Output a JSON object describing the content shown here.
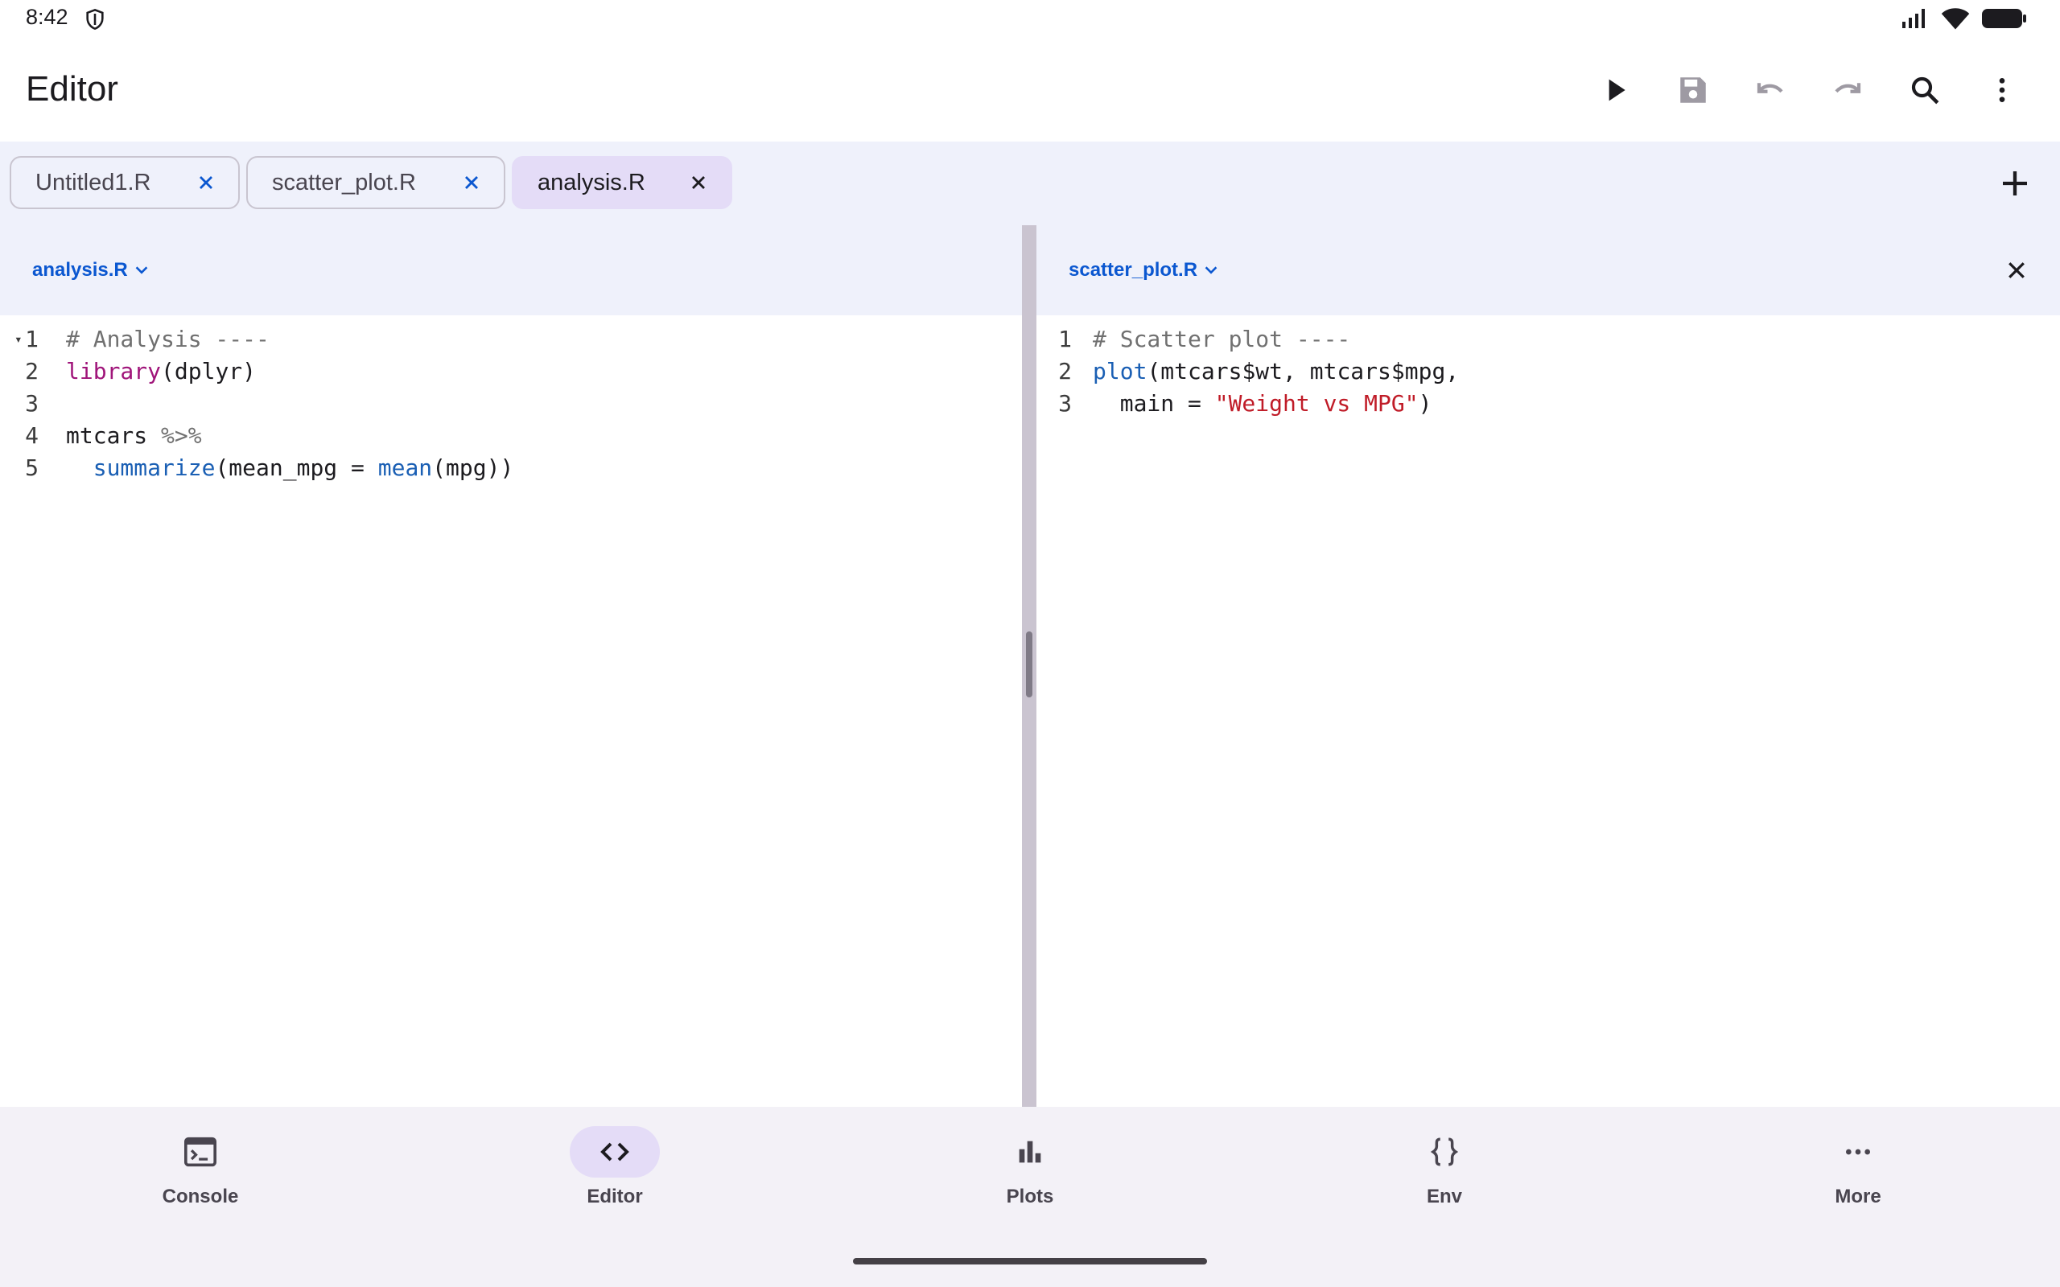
{
  "status": {
    "time": "8:42"
  },
  "appbar": {
    "title": "Editor"
  },
  "tabs": [
    {
      "label": "Untitled1.R"
    },
    {
      "label": "scatter_plot.R"
    },
    {
      "label": "analysis.R",
      "active": true
    }
  ],
  "left_pane": {
    "file": "analysis.R",
    "line_numbers": [
      "1",
      "2",
      "3",
      "4",
      "5"
    ],
    "lines": [
      [
        {
          "t": "# Analysis ----",
          "c": "comment"
        }
      ],
      [
        {
          "t": "library",
          "c": "fnlib"
        },
        {
          "t": "(dplyr)",
          "c": "plain"
        }
      ],
      [],
      [
        {
          "t": "mtcars ",
          "c": "plain"
        },
        {
          "t": "%>%",
          "c": "op"
        }
      ],
      [
        {
          "t": "  ",
          "c": "plain"
        },
        {
          "t": "summarize",
          "c": "fn"
        },
        {
          "t": "(mean_mpg = ",
          "c": "plain"
        },
        {
          "t": "mean",
          "c": "fn"
        },
        {
          "t": "(mpg))",
          "c": "plain"
        }
      ]
    ]
  },
  "right_pane": {
    "file": "scatter_plot.R",
    "line_numbers": [
      "1",
      "2",
      "3"
    ],
    "lines": [
      [
        {
          "t": "# Scatter plot ----",
          "c": "comment"
        }
      ],
      [
        {
          "t": "plot",
          "c": "fn"
        },
        {
          "t": "(mtcars$wt, mtcars$mpg,",
          "c": "plain"
        }
      ],
      [
        {
          "t": "  main = ",
          "c": "plain"
        },
        {
          "t": "\"Weight vs MPG\"",
          "c": "str"
        },
        {
          "t": ")",
          "c": "plain"
        }
      ]
    ]
  },
  "bottom_nav": [
    {
      "label": "Console",
      "icon": "console-icon"
    },
    {
      "label": "Editor",
      "icon": "code-icon",
      "active": true
    },
    {
      "label": "Plots",
      "icon": "bar-chart-icon"
    },
    {
      "label": "Env",
      "icon": "braces-icon"
    },
    {
      "label": "More",
      "icon": "more-horiz-icon"
    }
  ],
  "colors": {
    "accent": "#0b57d0",
    "active_tab": "#e4dcf7",
    "tab_strip": "#eff1fb",
    "nav_bg": "#f3f1f7"
  }
}
